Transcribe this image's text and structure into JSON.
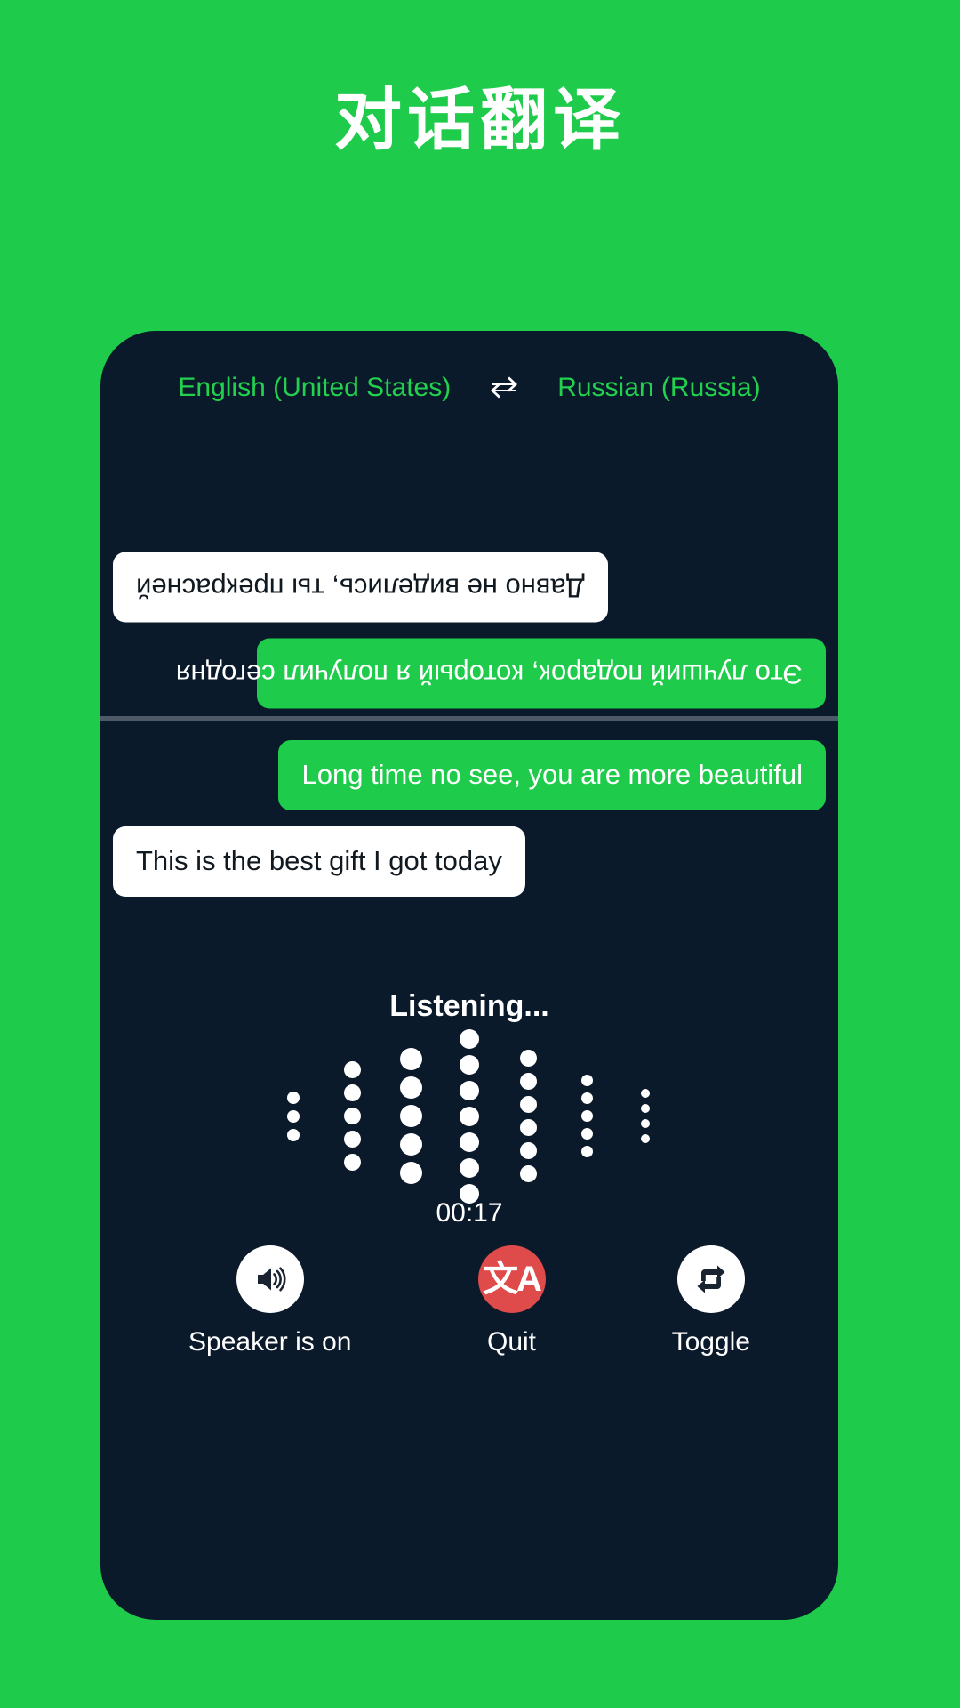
{
  "page": {
    "title": "对话翻译",
    "background_color": "#1ECB4B",
    "panel_color": "#0B1A2B",
    "accent_green": "#1ECB4B",
    "danger_color": "#DF4A4A"
  },
  "language_bar": {
    "source_language": "English (United States)",
    "swap_icon": "swap-horizontal-icon",
    "target_language": "Russian (Russia)"
  },
  "translated_pane": {
    "orientation": "rotated-180",
    "messages": [
      {
        "text": "Это лучший подарок, который я получил сегодня",
        "style": "remote",
        "icon": "chat-bubble"
      },
      {
        "text": "Давно не виделись, ты прекрасней",
        "style": "local",
        "icon": "chat-bubble"
      }
    ]
  },
  "source_pane": {
    "messages": [
      {
        "text": "Long time no see, you are more beautiful",
        "style": "remote",
        "icon": "chat-bubble"
      },
      {
        "text": "This is the best gift I got today",
        "style": "local",
        "icon": "chat-bubble"
      }
    ]
  },
  "listening": {
    "label": "Listening...",
    "timer": "00:17",
    "waveform": {
      "columns": [
        {
          "count": 3,
          "size": 14
        },
        {
          "count": 5,
          "size": 19
        },
        {
          "count": 5,
          "size": 25
        },
        {
          "count": 7,
          "size": 22
        },
        {
          "count": 6,
          "size": 19
        },
        {
          "count": 5,
          "size": 13
        },
        {
          "count": 4,
          "size": 10
        }
      ]
    }
  },
  "controls": [
    {
      "label": "Speaker is on",
      "icon": "speaker-on-icon",
      "variant": "light"
    },
    {
      "label": "Quit",
      "icon": "translate-icon",
      "variant": "danger",
      "glyph": "文A"
    },
    {
      "label": "Toggle",
      "icon": "swap-repeat-icon",
      "variant": "light"
    }
  ]
}
